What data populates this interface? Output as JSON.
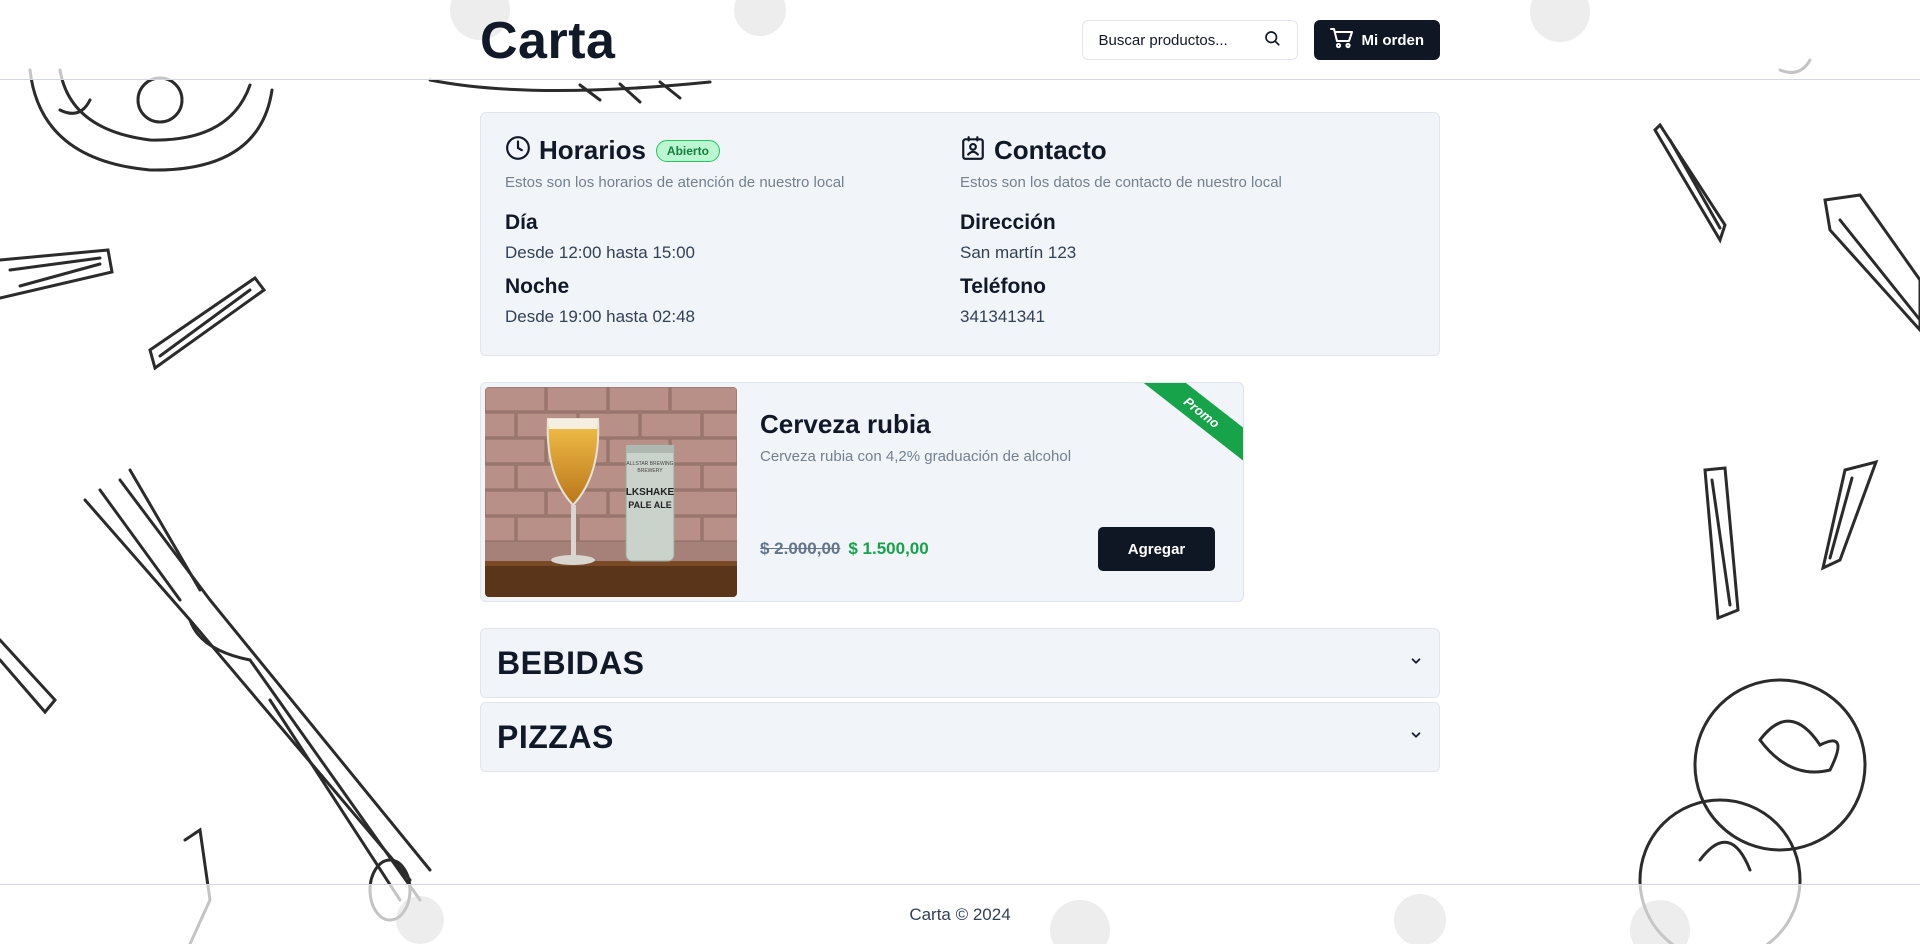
{
  "header": {
    "brand": "Carta",
    "search_placeholder": "Buscar productos...",
    "order_label": "Mi orden"
  },
  "hours": {
    "title": "Horarios",
    "badge": "Abierto",
    "subtitle": "Estos son los horarios de atención de nuestro local",
    "rows": [
      {
        "label": "Día",
        "value": "Desde 12:00 hasta 15:00"
      },
      {
        "label": "Noche",
        "value": "Desde 19:00 hasta 02:48"
      }
    ]
  },
  "contact": {
    "title": "Contacto",
    "subtitle": "Estos son los datos de contacto de nuestro local",
    "rows": [
      {
        "label": "Dirección",
        "value": "San martín 123"
      },
      {
        "label": "Teléfono",
        "value": "341341341"
      }
    ]
  },
  "promo": {
    "ribbon": "Promo",
    "name": "Cerveza rubia",
    "description": "Cerveza rubia con 4,2% graduación de alcohol",
    "old_price": "$ 2.000,00",
    "new_price": "$ 1.500,00",
    "add_label": "Agregar",
    "image": {
      "can_lines": [
        "ALLSTAR BREWING",
        "BREWERY",
        "LKSHAKE",
        "PALE ALE"
      ]
    }
  },
  "categories": [
    {
      "title": "BEBIDAS"
    },
    {
      "title": "PIZZAS"
    }
  ],
  "footer": {
    "text": "Carta © 2024"
  },
  "colors": {
    "primary": "#0f1725",
    "card_bg": "#f1f4f8",
    "accent_green": "#16a34a",
    "badge_bg": "#bbf7d0"
  },
  "icons": {
    "search": "search-icon",
    "cart": "cart-icon",
    "clock": "clock-icon",
    "contact": "contact-card-icon",
    "chevron": "chevron-down-icon"
  }
}
